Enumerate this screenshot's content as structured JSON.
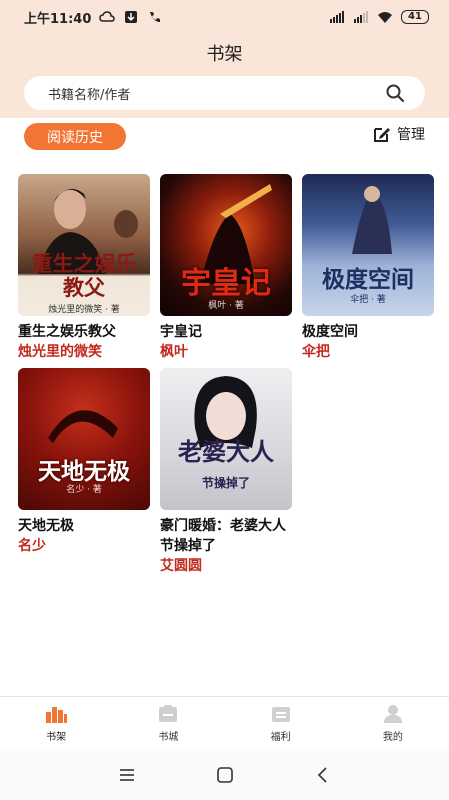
{
  "status_bar": {
    "time": "上午11:40",
    "battery": "41"
  },
  "header": {
    "title": "书架"
  },
  "search": {
    "placeholder": "书籍名称/作者"
  },
  "toolbar": {
    "history_label": "阅读历史",
    "manage_label": "管理"
  },
  "books": [
    {
      "title": "重生之娱乐教父",
      "author": "烛光里的微笑",
      "cover_title": "重生之娱乐教父",
      "cover_author": "烛光里的微笑 · 著"
    },
    {
      "title": "宇皇记",
      "author": "枫叶",
      "cover_title": "宇皇记",
      "cover_author": "枫叶 · 著"
    },
    {
      "title": "极度空间",
      "author": "伞把",
      "cover_title": "极度空间",
      "cover_author": "伞把 · 著"
    },
    {
      "title": "天地无极",
      "author": "名少",
      "cover_title": "天地无极",
      "cover_author": "名少 · 著"
    },
    {
      "title": "豪门暖婚：老婆大人节操掉了",
      "author": "艾圆圆",
      "cover_title": "老婆大人",
      "cover_author": "节操掉了"
    }
  ],
  "nav": [
    {
      "label": "书架",
      "active": true
    },
    {
      "label": "书城",
      "active": false
    },
    {
      "label": "福利",
      "active": false
    },
    {
      "label": "我的",
      "active": false
    }
  ],
  "colors": {
    "accent": "#f37533",
    "author_red": "#c32a1f",
    "header_bg": "#f9e6d8"
  }
}
